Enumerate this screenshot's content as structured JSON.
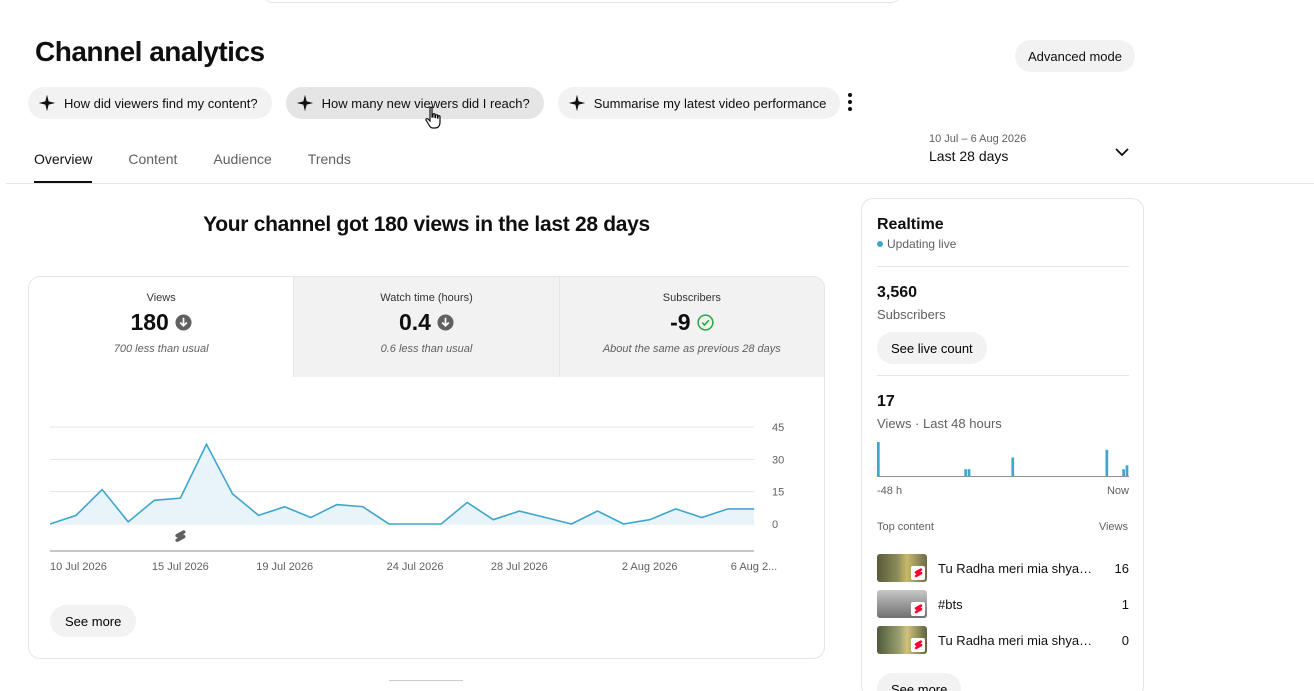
{
  "page": {
    "title": "Channel analytics",
    "advanced_mode_label": "Advanced mode"
  },
  "chips": [
    {
      "label": "How did viewers find my content?"
    },
    {
      "label": "How many new viewers did I reach?"
    },
    {
      "label": "Summarise my latest video performance"
    }
  ],
  "tabs": [
    {
      "label": "Overview",
      "active": true
    },
    {
      "label": "Content"
    },
    {
      "label": "Audience"
    },
    {
      "label": "Trends"
    }
  ],
  "date_range": {
    "range": "10 Jul – 6 Aug 2026",
    "label": "Last 28 days"
  },
  "headline": "Your channel got 180 views in the last 28 days",
  "metrics": [
    {
      "label": "Views",
      "value": "180",
      "note": "700 less than usual",
      "status": "down"
    },
    {
      "label": "Watch time (hours)",
      "value": "0.4",
      "note": "0.6 less than usual",
      "status": "down"
    },
    {
      "label": "Subscribers",
      "value": "-9",
      "note": "About the same as previous 28 days",
      "status": "ok"
    }
  ],
  "chart_data": {
    "type": "area",
    "x": [
      "10 Jul 2026",
      "11 Jul 2026",
      "12 Jul 2026",
      "13 Jul 2026",
      "14 Jul 2026",
      "15 Jul 2026",
      "16 Jul 2026",
      "17 Jul 2026",
      "18 Jul 2026",
      "19 Jul 2026",
      "20 Jul 2026",
      "21 Jul 2026",
      "22 Jul 2026",
      "23 Jul 2026",
      "24 Jul 2026",
      "25 Jul 2026",
      "26 Jul 2026",
      "27 Jul 2026",
      "28 Jul 2026",
      "29 Jul 2026",
      "30 Jul 2026",
      "31 Jul 2026",
      "1 Aug 2026",
      "2 Aug 2026",
      "3 Aug 2026",
      "4 Aug 2026",
      "5 Aug 2026",
      "6 Aug 2026"
    ],
    "series": [
      {
        "values": [
          0,
          4,
          16,
          1,
          11,
          12,
          37,
          14,
          4,
          8,
          3,
          9,
          8,
          0,
          0,
          0,
          10,
          2,
          6,
          3,
          0,
          6,
          0,
          2,
          7,
          3,
          7,
          7
        ]
      }
    ],
    "x_tick_labels": [
      "10 Jul 2026",
      "15 Jul 2026",
      "19 Jul 2026",
      "24 Jul 2026",
      "28 Jul 2026",
      "2 Aug 2026",
      "6 Aug 2..."
    ],
    "x_tick_index": [
      0,
      5,
      9,
      14,
      18,
      23,
      27
    ],
    "y_ticks": [
      "0",
      "15",
      "30",
      "45"
    ],
    "ylim": [
      0,
      45
    ],
    "grid": true,
    "line_color": "#3ea6cd",
    "fill_color": "#e8f4fa",
    "marker_index": 5
  },
  "see_more_label": "See more",
  "realtime": {
    "title": "Realtime",
    "status": "Updating live",
    "subscribers_value": "3,560",
    "subscribers_label": "Subscribers",
    "live_count_label": "See live count",
    "views_value": "17",
    "views_label": "Views · Last 48 hours",
    "axis_start": "-48 h",
    "axis_end": "Now",
    "top_content_label": "Top content",
    "views_col_label": "Views",
    "see_more_label": "See more",
    "bars_chart": {
      "type": "bar",
      "values": [
        9,
        0,
        0,
        0,
        0,
        0,
        0,
        0,
        0,
        0,
        0,
        0,
        0,
        0,
        0,
        0,
        0,
        0,
        0,
        0,
        0,
        0,
        0,
        0,
        0,
        0,
        2,
        2,
        0,
        0,
        0,
        0,
        0,
        0,
        0,
        0,
        0,
        0,
        0,
        0,
        5,
        0,
        0,
        0,
        0,
        0,
        0,
        0,
        0,
        0,
        0,
        0,
        0,
        0,
        0,
        0,
        0,
        0,
        0,
        0,
        0,
        0,
        0,
        0,
        0,
        0,
        0,
        0,
        7,
        0,
        0,
        0,
        0,
        2,
        3
      ]
    },
    "top_content": [
      {
        "title": "Tu Radha meri mia shyam...",
        "views": "16"
      },
      {
        "title": "#bts",
        "views": "1"
      },
      {
        "title": "Tu Radha meri mia shyam ...",
        "views": "0"
      }
    ]
  },
  "colors": {
    "accent": "#3ea6cd",
    "chip_bg": "#f2f2f2",
    "ok_green": "#2ba640"
  }
}
